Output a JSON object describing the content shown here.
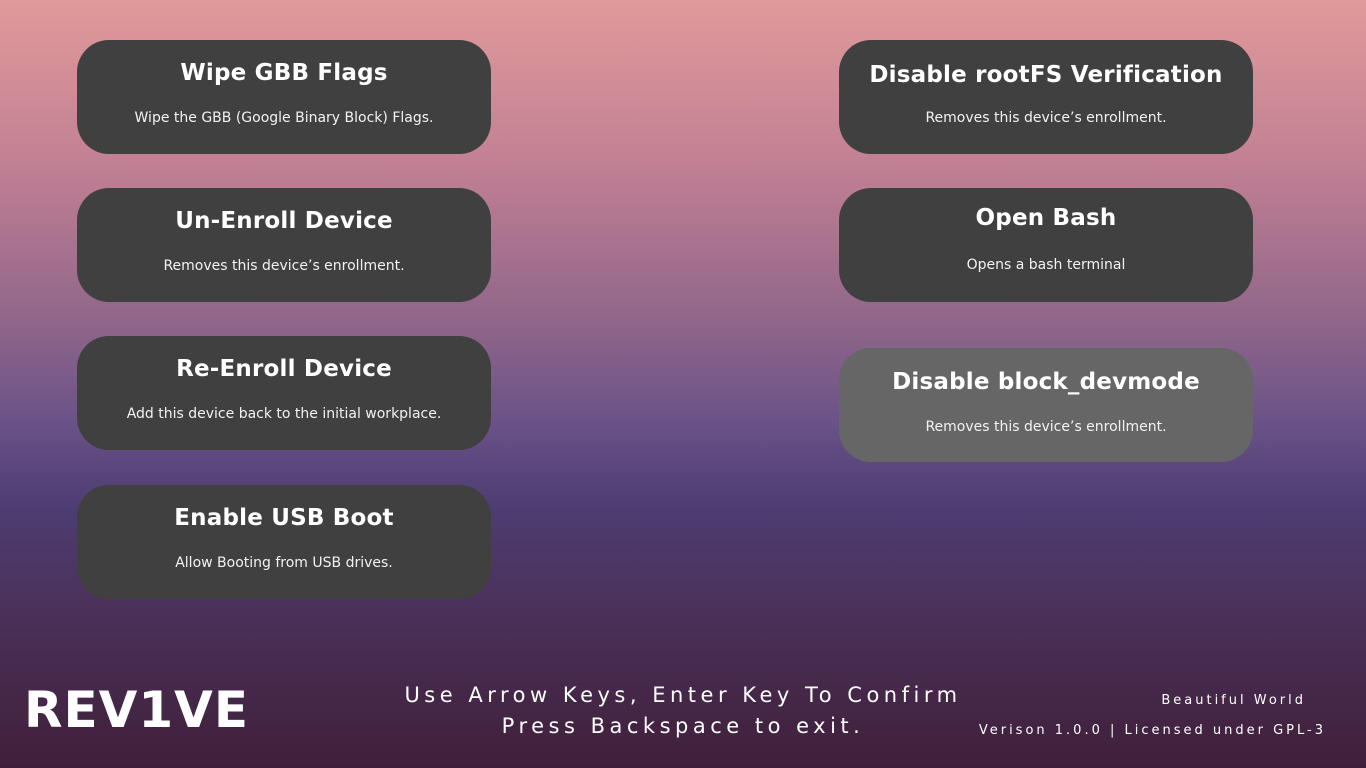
{
  "menu": {
    "left": [
      {
        "title": "Wipe GBB Flags",
        "description": "Wipe the GBB (Google Binary Block) Flags."
      },
      {
        "title": "Un-Enroll Device",
        "description": "Removes this device’s enrollment."
      },
      {
        "title": "Re-Enroll Device",
        "description": "Add this device back to the initial workplace."
      },
      {
        "title": "Enable USB Boot",
        "description": "Allow Booting from USB drives."
      }
    ],
    "right": [
      {
        "title": "Disable rootFS Verification",
        "description": "Removes this device’s enrollment."
      },
      {
        "title": "Open Bash",
        "description": "Opens a bash terminal"
      },
      {
        "title": "Disable block_devmode",
        "description": "Removes this device’s enrollment."
      }
    ],
    "selected": "Disable block_devmode"
  },
  "footer": {
    "logo": "REV1VE",
    "instructions_line1": "Use Arrow Keys, Enter Key To Confirm",
    "instructions_line2": "Press Backspace to exit.",
    "tagline": "Beautiful World",
    "version": "Verison 1.0.0 | Licensed under GPL-3"
  },
  "colors": {
    "card_bg": "#404040",
    "card_selected_bg": "#666666",
    "text": "#ffffff"
  }
}
